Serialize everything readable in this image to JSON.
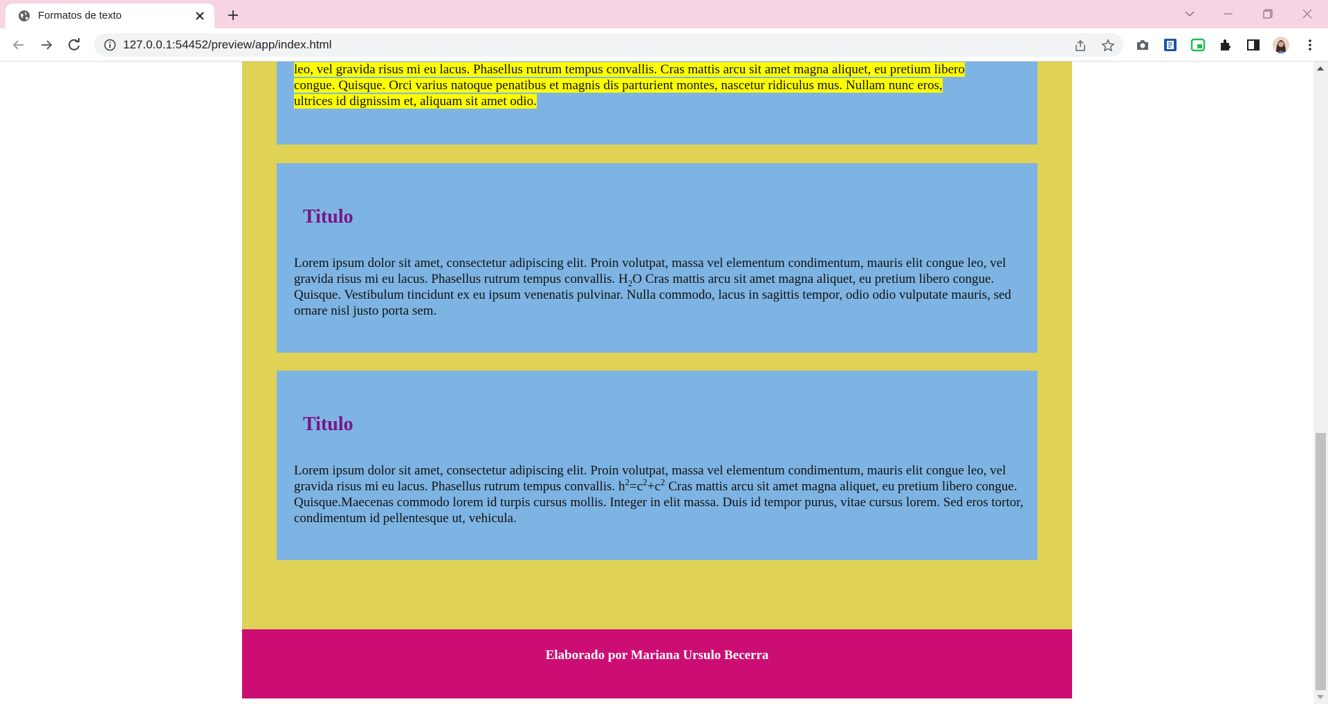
{
  "browser": {
    "tab_title": "Formatos de texto",
    "url": "127.0.0.1:54452/preview/app/index.html",
    "tabbar_color": "#f7d4e3"
  },
  "page": {
    "colors": {
      "container": "#e0d255",
      "card": "#7eb4e3",
      "heading": "#7b1585",
      "highlight": "#ffff00",
      "footer": "#cc0e74"
    },
    "card1": {
      "line1": "leo, vel gravida risus mi eu lacus. Phasellus rutrum tempus convallis. Cras mattis arcu sit amet magna aliquet, eu pretium libero",
      "line2": "congue. Quisque. Orci varius natoque penatibus et magnis dis parturient montes, nascetur ridiculus mus. Nullam nunc eros,",
      "line3": "ultrices id dignissim et, aliquam sit amet odio."
    },
    "card2": {
      "title": "Titulo",
      "text_a": "Lorem ipsum dolor sit amet, consectetur adipiscing elit. Proin volutpat, massa vel elementum condimentum, mauris elit congue leo, vel gravida risus mi eu lacus. Phasellus rutrum tempus convallis. H",
      "sub": "2",
      "text_b": "O Cras mattis arcu sit amet magna aliquet, eu pretium libero congue. Quisque. Vestibulum tincidunt ex eu ipsum venenatis pulvinar. Nulla commodo, lacus in sagittis tempor, odio odio vulputate mauris, sed ornare nisl justo porta sem."
    },
    "card3": {
      "title": "Titulo",
      "text_a": "Lorem ipsum dolor sit amet, consectetur adipiscing elit. Proin volutpat, massa vel elementum condimentum, mauris elit congue leo, vel gravida risus mi eu lacus. Phasellus rutrum tempus convallis. h",
      "sup1": "2",
      "text_b": "=c",
      "sup2": "2",
      "text_c": "+c",
      "sup3": "2",
      "text_d": " Cras mattis arcu sit amet magna aliquet, eu pretium libero congue. Quisque.Maecenas commodo lorem id turpis cursus mollis. Integer in elit massa. Duis id tempor purus, vitae cursus lorem. Sed eros tortor, condimentum id pellentesque ut, vehicula."
    },
    "footer": "Elaborado por Mariana Ursulo Becerra"
  }
}
